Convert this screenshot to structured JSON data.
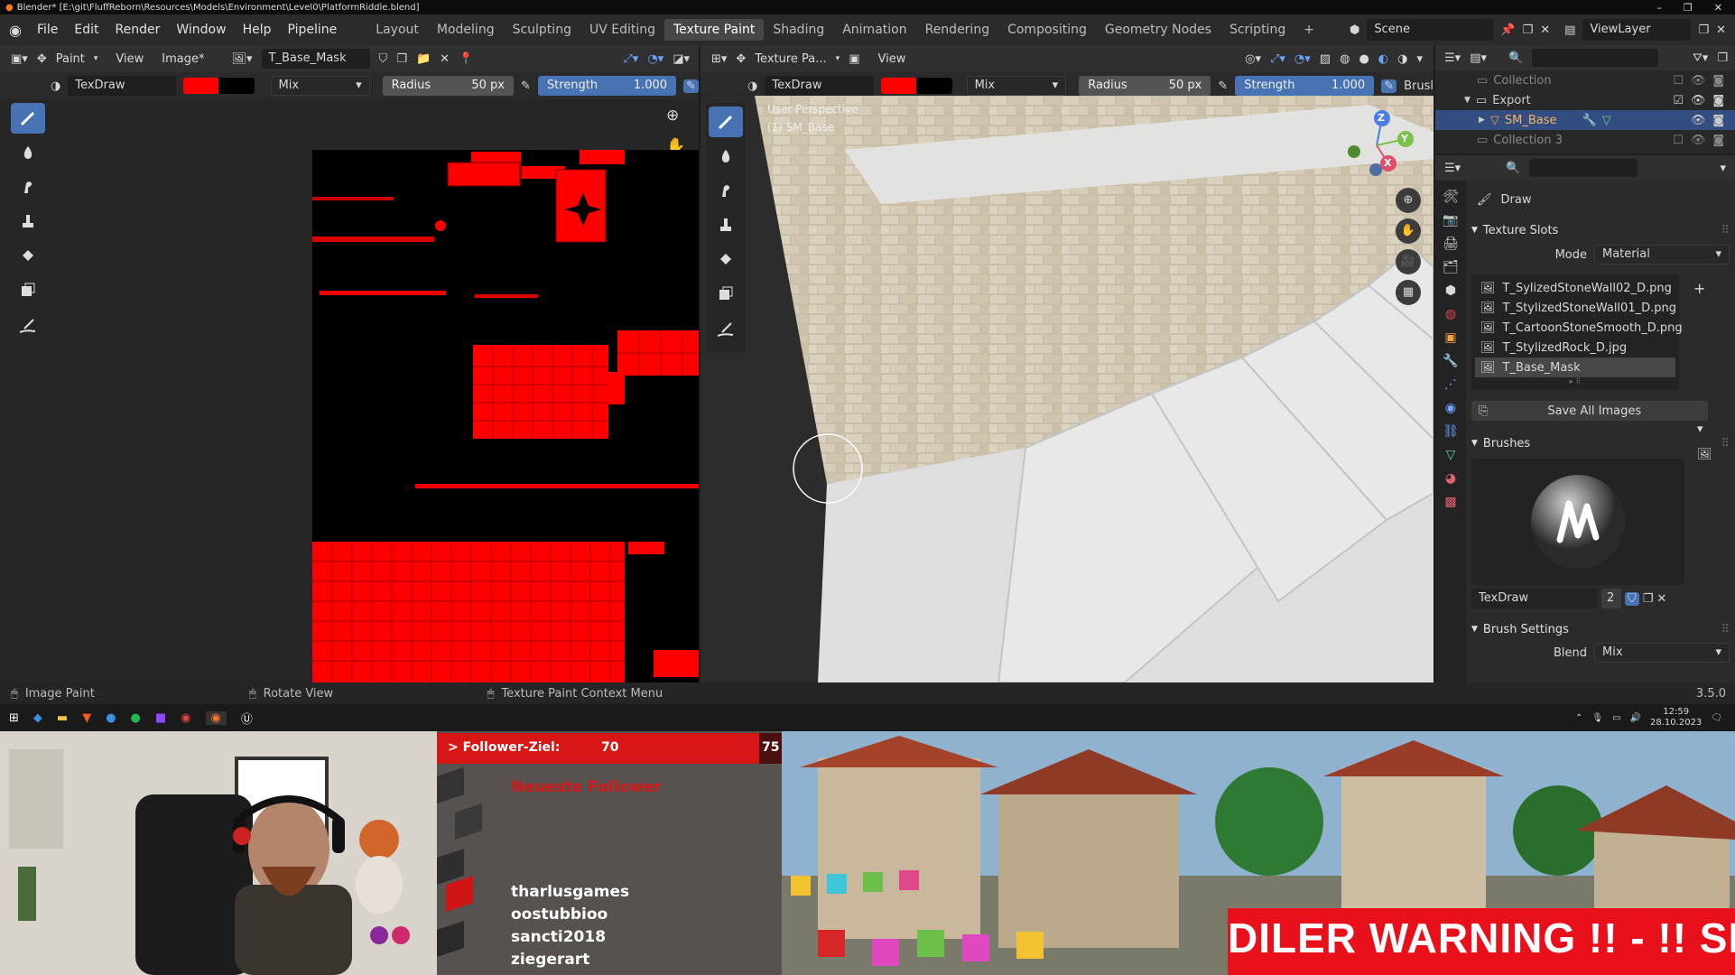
{
  "titlebar": {
    "text": "Blender* [E:\\git\\FluffReborn\\Resources\\Models\\Environment\\Level0\\PlatformRiddle.blend]"
  },
  "menu": [
    "File",
    "Edit",
    "Render",
    "Window",
    "Help",
    "Pipeline"
  ],
  "workspaces": [
    "Layout",
    "Modeling",
    "Sculpting",
    "UV Editing",
    "Texture Paint",
    "Shading",
    "Animation",
    "Rendering",
    "Compositing",
    "Geometry Nodes",
    "Scripting"
  ],
  "active_workspace": "Texture Paint",
  "scene": {
    "label": "Scene",
    "viewlayer": "ViewLayer"
  },
  "image_editor": {
    "mode": "Paint",
    "view": "View",
    "image": "Image*",
    "image_name": "T_Base_Mask",
    "brush": "TexDraw",
    "blend": "Mix",
    "radius_label": "Radius",
    "radius_value": "50 px",
    "strength_label": "Strength",
    "strength_value": "1.000",
    "color_primary": "#ff0000",
    "color_secondary": "#000000"
  },
  "viewport": {
    "editor_type": "Texture Pa...",
    "view": "View",
    "brush": "TexDraw",
    "blend": "Mix",
    "radius_label": "Radius",
    "radius_value": "50 px",
    "strength_label": "Strength",
    "strength_value": "1.000",
    "brush_cut": "Brusl",
    "overlay_line1": "User Perspective",
    "overlay_line2": "(1) SM_Base",
    "gizmo": {
      "z": "Z",
      "y": "Y",
      "x": "X"
    }
  },
  "outliner": {
    "items": [
      {
        "label": "Collection",
        "indent": 0
      },
      {
        "label": "Export",
        "indent": 0
      },
      {
        "label": "SM_Base",
        "indent": 1,
        "selected": true
      },
      {
        "label": "Collection 3",
        "indent": 0
      }
    ]
  },
  "properties": {
    "tool_name": "Draw",
    "texture_slots_title": "Texture Slots",
    "mode_label": "Mode",
    "mode_value": "Material",
    "slots": [
      "T_SylizedStoneWall02_D.png",
      "T_StylizedStoneWall01_D.png",
      "T_CartoonStoneSmooth_D.png",
      "T_StylizedRock_D.jpg",
      "T_Base_Mask"
    ],
    "active_slot": 4,
    "save_all": "Save All Images",
    "brushes_title": "Brushes",
    "brush_name": "TexDraw",
    "brush_users": "2",
    "brush_settings_title": "Brush Settings",
    "blend_label": "Blend",
    "blend_value": "Mix"
  },
  "statusbar": {
    "left": "Image Paint",
    "middle": "Rotate View",
    "right": "Texture Paint Context Menu",
    "version": "3.5.0"
  },
  "taskbar": {
    "time": "12:59",
    "date": "28.10.2023"
  },
  "stream": {
    "goal_label": "> Follower-Ziel:",
    "goal_current": "70",
    "goal_target": "75",
    "goal_progress": 0.9333,
    "newest_title": "Neueste Follower",
    "followers": [
      "tharlusgames",
      "oostubbioo",
      "sancti2018",
      "ziegerart"
    ],
    "ticker": "DILER WARNING !! - !! SP"
  }
}
